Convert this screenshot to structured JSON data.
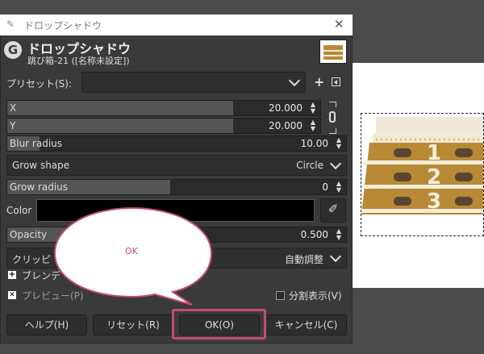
{
  "window": {
    "title": "ドロップシャドウ"
  },
  "header": {
    "title": "ドロップシャドウ",
    "subtitle": "跳び箱-21 ([名称未設定])"
  },
  "preset": {
    "label": "プリセット(S):",
    "value": ""
  },
  "fields": {
    "x": {
      "label": "X",
      "value": "20.000"
    },
    "y": {
      "label": "Y",
      "value": "20.000"
    },
    "blur": {
      "label": "Blur radius",
      "value": "10.00"
    },
    "grow_shape": {
      "label": "Grow shape",
      "value": "Circle"
    },
    "grow_radius": {
      "label": "Grow radius",
      "value": "0"
    },
    "color": {
      "label": "Color",
      "value": "#000000"
    },
    "opacity": {
      "label": "Opacity",
      "value": "0.500"
    }
  },
  "clipping": {
    "label": "クリッピ",
    "value": "自動調整"
  },
  "blending": {
    "label": "ブレンデ"
  },
  "preview": {
    "label": "プレビュー(P)",
    "split_label": "分割表示(V)"
  },
  "buttons": {
    "help": "ヘルプ(H)",
    "reset": "リセット(R)",
    "ok": "OK(O)",
    "cancel": "キャンセル(C)"
  },
  "callout": {
    "text": "OK"
  },
  "image": {
    "numbers": [
      "1",
      "2",
      "3"
    ]
  },
  "colors": {
    "accent": "#c24b76",
    "highlight": "#d94f86",
    "wood": "#b98b38"
  }
}
